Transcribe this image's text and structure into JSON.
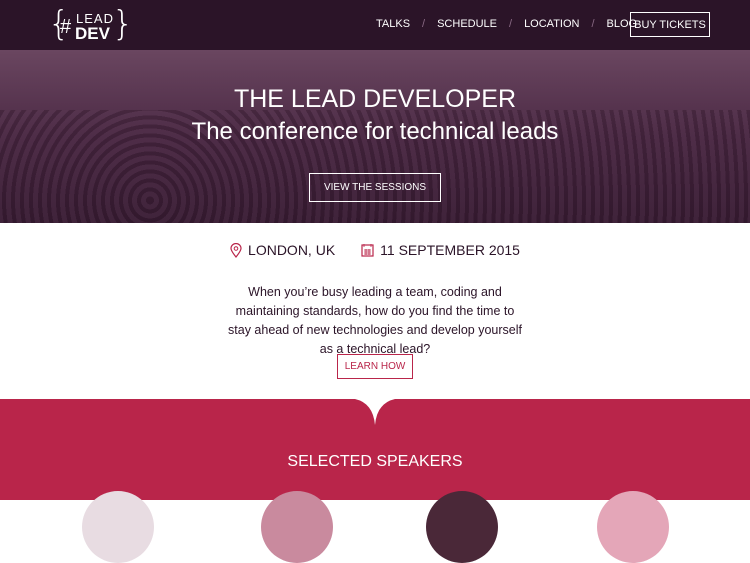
{
  "header": {
    "logo_top": "LEAD",
    "logo_bottom": "DEV",
    "logo_hash": "#",
    "nav": [
      "TALKS",
      "SCHEDULE",
      "LOCATION",
      "BLOG"
    ],
    "buy_label": "BUY TICKETS"
  },
  "hero": {
    "title": "THE LEAD DEVELOPER",
    "subtitle": "The conference for technical leads",
    "cta": "VIEW THE SESSIONS"
  },
  "event": {
    "location": "LONDON, UK",
    "date": "11 SEPTEMBER 2015"
  },
  "intro": {
    "text": "When you’re busy leading a team, coding and maintaining standards, how do you find the time to stay ahead of new technologies and develop yourself as a technical lead?",
    "cta": "LEARN HOW"
  },
  "speakers": {
    "title": "SELECTED SPEAKERS"
  },
  "colors": {
    "header": "#2b1428",
    "accent": "#b9254a"
  }
}
